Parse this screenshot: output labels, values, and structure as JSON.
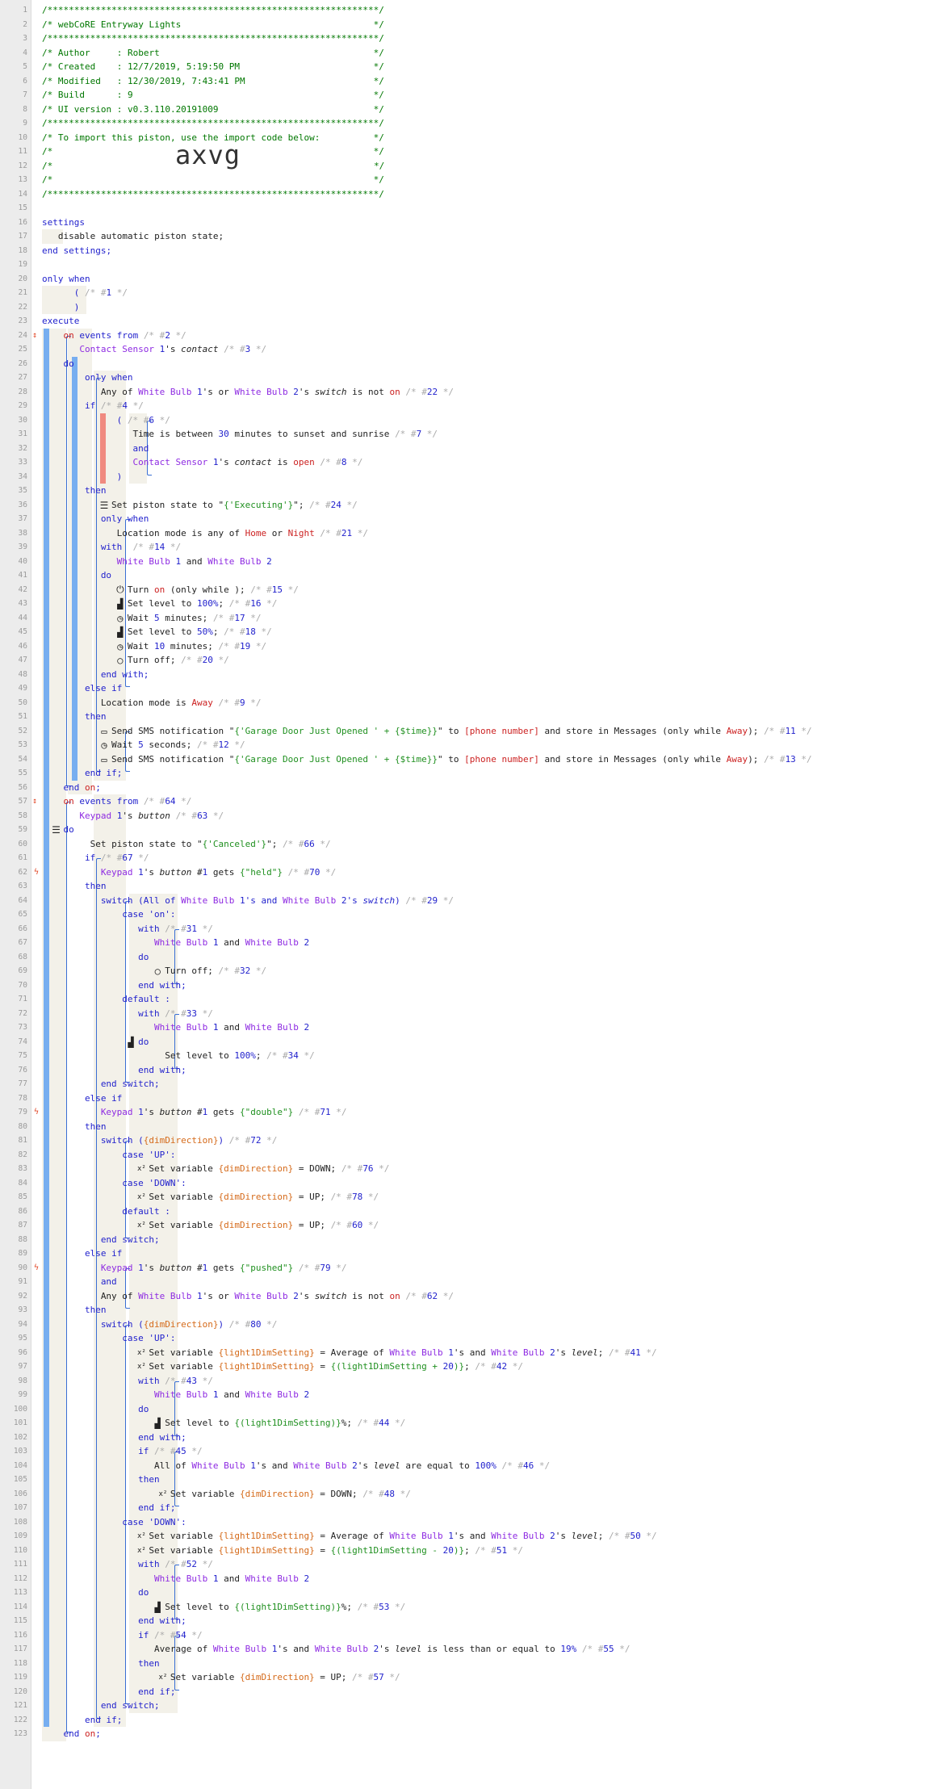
{
  "lines": [
    "/**************************************************************/",
    "/* webCoRE Entryway Lights                                    */",
    "/**************************************************************/",
    "/* Author     : Robert                                        */",
    "/* Created    : 12/7/2019, 5:19:50 PM                         */",
    "/* Modified   : 12/30/2019, 7:43:41 PM                        */",
    "/* Build      : 9                                             */",
    "/* UI version : v0.3.110.20191009                             */",
    "/**************************************************************/",
    "/* To import this piston, use the import code below:          */",
    "/*                                                            */",
    "/*                 axvg                                       */",
    "/*                                                            */",
    "/**************************************************************/",
    "",
    "settings",
    "    disable automatic piston state;",
    "end settings;",
    "",
    "only when",
    "        ( /* #1 */",
    "        )",
    "execute",
    "on events from /* #2 */",
    "    Contact Sensor 1's contact /* #3 */",
    "do",
    "only when",
    "    Any of White Bulb 1's or White Bulb 2's switch is not on /* #22 */",
    "if /* #4 */",
    "        ( /* #6 */",
    "            Time is between 30 minutes to sunset and sunrise /* #7 */",
    "            and",
    "            Contact Sensor 1's contact is open /* #8 */",
    "        )",
    "then",
    "    Set piston state to \"{'Executing'}\"; /* #24 */",
    "    only when",
    "        Location mode is any of Home or Night /* #21 */",
    "    with  /* #14 */",
    "        White Bulb 1 and White Bulb 2",
    "    do",
    "        Turn on (only while ); /* #15 */",
    "        Set level to 100%; /* #16 */",
    "        Wait 5 minutes; /* #17 */",
    "        Set level to 50%; /* #18 */",
    "        Wait 10 minutes; /* #19 */",
    "        Turn off; /* #20 */",
    "    end with;",
    "else if",
    "    Location mode is Away /* #9 */",
    "then",
    "    Send SMS notification \"{'Garage Door Just Opened ' + {$time}}\" to [phone number] and store in Messages (only while Away); /* #11 */",
    "    Wait 5 seconds; /* #12 */",
    "    Send SMS notification \"{'Garage Door Just Opened ' + {$time}}\" to [phone number] and store in Messages (only while Away); /* #13 */",
    "end if;",
    "end on;",
    "on events from /* #64 */",
    "    Keypad 1's button /* #63 */",
    "do",
    "    Set piston state to \"{'Canceled'}\"; /* #66 */",
    "if /* #67 */",
    "    Keypad 1's button #1 gets {\"held\"} /* #70 */",
    "then",
    "    switch (All of White Bulb 1's and White Bulb 2's switch) /* #29 */",
    "        case 'on':",
    "            with /* #31 */",
    "                White Bulb 1 and White Bulb 2",
    "            do",
    "                Turn off; /* #32 */",
    "            end with;",
    "        default :",
    "            with /* #33 */",
    "                White Bulb 1 and White Bulb 2",
    "            do",
    "                Set level to 100%; /* #34 */",
    "            end with;",
    "    end switch;",
    "else if",
    "    Keypad 1's button #1 gets {\"double\"} /* #71 */",
    "then",
    "    switch ({dimDirection}) /* #72 */",
    "        case 'UP':",
    "            Set variable {dimDirection} = DOWN; /* #76 */",
    "        case 'DOWN':",
    "            Set variable {dimDirection} = UP; /* #78 */",
    "        default :",
    "            Set variable {dimDirection} = UP; /* #60 */",
    "    end switch;",
    "else if",
    "    Keypad 1's button #1 gets {\"pushed\"} /* #79 */",
    "    and",
    "    Any of White Bulb 1's or White Bulb 2's switch is not on /* #62 */",
    "then",
    "    switch ({dimDirection}) /* #80 */",
    "        case 'UP':",
    "            Set variable {light1DimSetting} = Average of White Bulb 1's and White Bulb 2's level; /* #41 */",
    "            Set variable {light1DimSetting} = {(light1DimSetting + 20)}; /* #42 */",
    "            with /* #43 */",
    "                White Bulb 1 and White Bulb 2",
    "            do",
    "                Set level to {(light1DimSetting)}%; /* #44 */",
    "            end with;",
    "            if /* #45 */",
    "                All of White Bulb 1's and White Bulb 2's level are equal to 100% /* #46 */",
    "            then",
    "                Set variable {dimDirection} = DOWN; /* #48 */",
    "            end if;",
    "        case 'DOWN':",
    "            Set variable {light1DimSetting} = Average of White Bulb 1's and White Bulb 2's level; /* #50 */",
    "            Set variable {light1DimSetting} = {(light1DimSetting - 20)}; /* #51 */",
    "            with /* #52 */",
    "                White Bulb 1 and White Bulb 2",
    "            do",
    "                Set level to {(light1DimSetting)}%; /* #53 */",
    "            end with;",
    "            if /* #54 */",
    "                Average of White Bulb 1's and White Bulb 2's level is less than or equal to 19% /* #55 */",
    "            then",
    "                Set variable {dimDirection} = UP; /* #57 */",
    "            end if;",
    "    end switch;",
    "end if;",
    "end on;"
  ],
  "icons": {
    "36": "list-icon",
    "42": "power-icon",
    "43": "signal-icon",
    "44": "clock-icon",
    "45": "signal-icon",
    "46": "clock-icon",
    "47": "power-off-icon",
    "52": "message-icon",
    "53": "clock-icon",
    "54": "message-icon",
    "59": "list-icon",
    "69": "power-off-icon",
    "74": "signal-icon",
    "83": "variable-icon",
    "85": "variable-icon",
    "87": "variable-icon",
    "96": "variable-icon",
    "97": "variable-icon",
    "101": "signal-icon",
    "106": "variable-icon",
    "109": "variable-icon",
    "110": "variable-icon",
    "114": "signal-icon",
    "119": "variable-icon"
  },
  "colors": {
    "comment": "#007700",
    "keyword": "#1f1fcc",
    "device": "#8e2be2",
    "value": "#cc2222",
    "variable": "#d56a1a",
    "string": "#209020",
    "muted": "#aaaaaa",
    "bar_blue": "#77aef0",
    "bar_red": "#f08a80"
  }
}
